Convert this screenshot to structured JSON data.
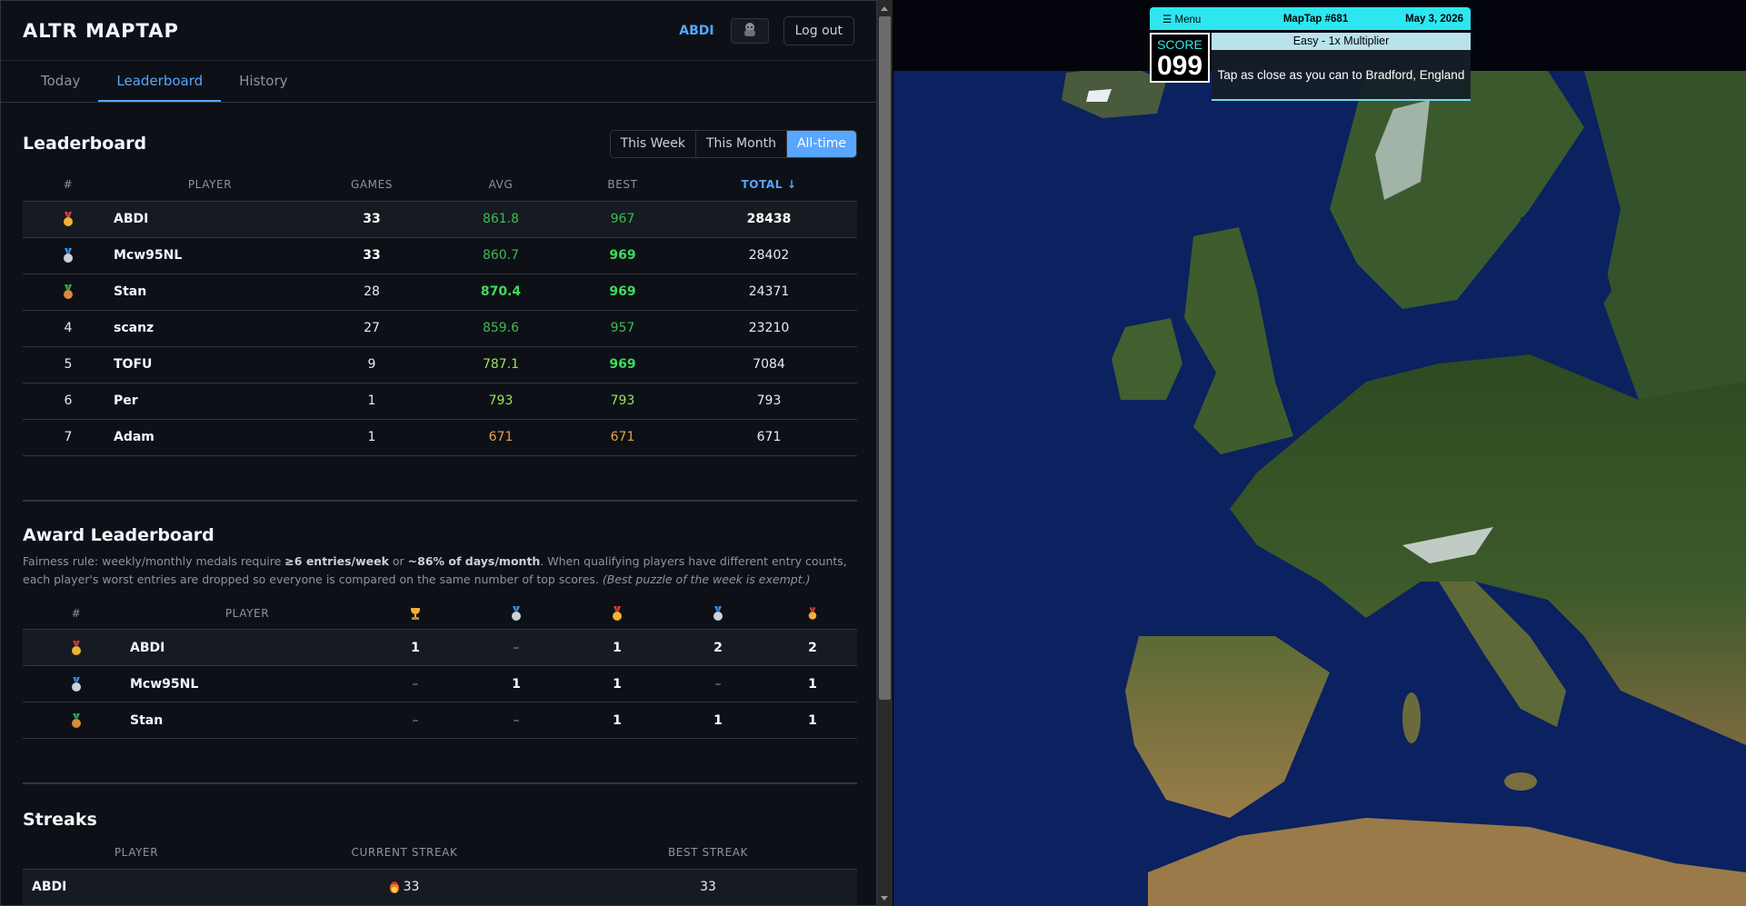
{
  "app": {
    "title": "ALTR MAPTAP",
    "user": "ABDI",
    "logout_label": "Log out"
  },
  "tabs": [
    "Today",
    "Leaderboard",
    "History"
  ],
  "leaderboard": {
    "title": "Leaderboard",
    "ranges": [
      "This Week",
      "This Month",
      "All-time"
    ],
    "active_range": "All-time",
    "columns": [
      "#",
      "PLAYER",
      "GAMES",
      "AVG",
      "BEST",
      "TOTAL ↓"
    ],
    "rows": [
      {
        "rank": "1",
        "medal": "gold",
        "player": "ABDI",
        "games": "33",
        "avg": "861.8",
        "best": "967",
        "total": "28438"
      },
      {
        "rank": "2",
        "medal": "silver",
        "player": "Mcw95NL",
        "games": "33",
        "avg": "860.7",
        "best": "969",
        "total": "28402"
      },
      {
        "rank": "3",
        "medal": "bronze",
        "player": "Stan",
        "games": "28",
        "avg": "870.4",
        "best": "969",
        "total": "24371"
      },
      {
        "rank": "4",
        "player": "scanz",
        "games": "27",
        "avg": "859.6",
        "best": "957",
        "total": "23210"
      },
      {
        "rank": "5",
        "player": "TOFU",
        "games": "9",
        "avg": "787.1",
        "best": "969",
        "total": "7084"
      },
      {
        "rank": "6",
        "player": "Per",
        "games": "1",
        "avg": "793",
        "best": "793",
        "total": "793"
      },
      {
        "rank": "7",
        "player": "Adam",
        "games": "1",
        "avg": "671",
        "best": "671",
        "total": "671"
      }
    ]
  },
  "awards": {
    "title": "Award Leaderboard",
    "fairness": {
      "p1": "Fairness rule: weekly/monthly medals require ",
      "b1": "≥6 entries/week",
      "p2": " or ",
      "b2": "~86% of days/month",
      "p3": ". When qualifying players have different entry counts, each player's worst entries are dropped so everyone is compared on the same number of top scores. ",
      "i1": "(Best puzzle of the week is exempt.)"
    },
    "columns": [
      "#",
      "PLAYER"
    ],
    "column_icons": [
      "trophy-icon",
      "silver-medal-icon",
      "gold-medal-icon",
      "silver-medal-icon",
      "gold-medal-icon"
    ],
    "rows": [
      {
        "medal": "gold",
        "player": "ABDI",
        "vals": [
          "1",
          "–",
          "1",
          "2",
          "2"
        ]
      },
      {
        "medal": "silver",
        "player": "Mcw95NL",
        "vals": [
          "–",
          "1",
          "1",
          "–",
          "1"
        ]
      },
      {
        "medal": "bronze",
        "player": "Stan",
        "vals": [
          "–",
          "–",
          "1",
          "1",
          "1"
        ]
      }
    ]
  },
  "streaks": {
    "title": "Streaks",
    "columns": [
      "PLAYER",
      "CURRENT STREAK",
      "BEST STREAK"
    ],
    "rows": [
      {
        "player": "ABDI",
        "current": "33",
        "best": "33"
      }
    ]
  },
  "maptap": {
    "menu_label": "☰ Menu",
    "game": "MapTap #681",
    "date": "May 3, 2026",
    "score_label": "SCORE",
    "score": "099",
    "difficulty": "Easy - 1x Multiplier",
    "prompt": "Tap as close as you can to Bradford, England"
  },
  "colors": {
    "accent": "#58a6ff",
    "background": "#0d1117",
    "best_green": "#3ddc5a",
    "maptap_cyan": "#2ee6f0",
    "sea": "#0a1e55"
  }
}
